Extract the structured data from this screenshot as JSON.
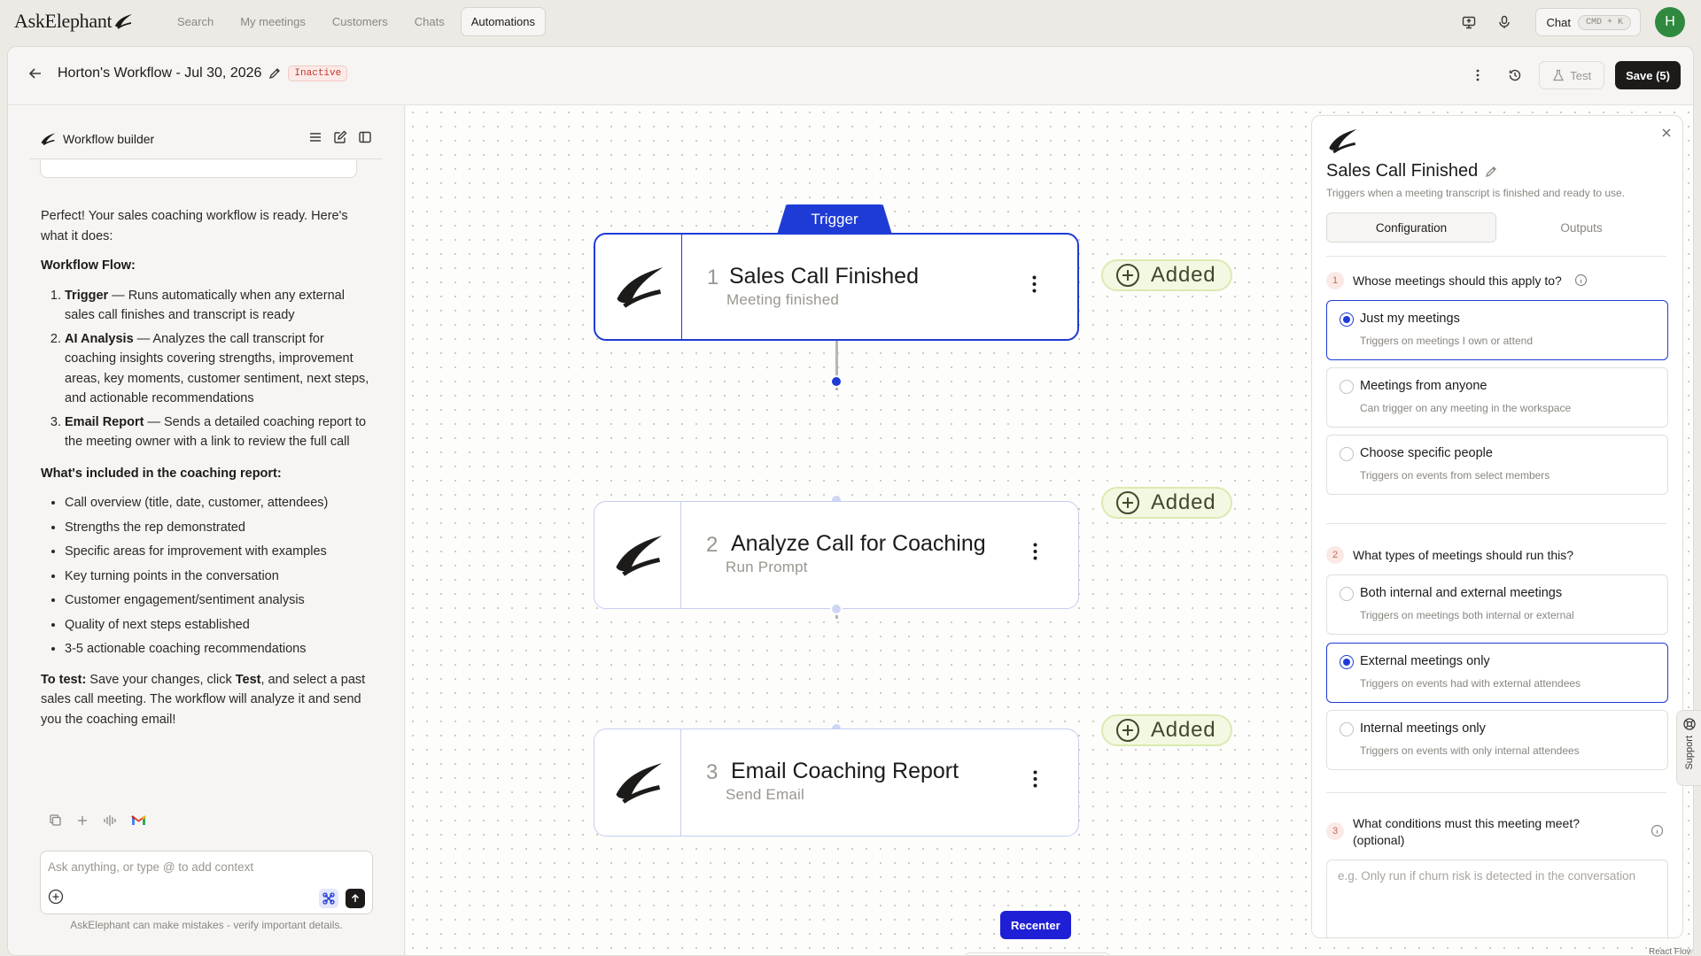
{
  "app": {
    "logo_text": "AskElephant",
    "nav": [
      "Search",
      "My meetings",
      "Customers",
      "Chats",
      "Automations"
    ],
    "active_nav": "Automations",
    "chat_label": "Chat",
    "chat_shortcut": "CMD + K",
    "avatar_initial": "H"
  },
  "workflow": {
    "title": "Horton's Workflow - Jul 30, 2026",
    "status": "Inactive",
    "test_label": "Test",
    "save_label": "Save (5)"
  },
  "builder": {
    "title": "Workflow builder",
    "intro": "Perfect! Your sales coaching workflow is ready. Here's what it does:",
    "flow_heading": "Workflow Flow:",
    "flow_steps": [
      {
        "name": "Trigger",
        "desc": " — Runs automatically when any external sales call finishes and transcript is ready"
      },
      {
        "name": "AI Analysis",
        "desc": " — Analyzes the call transcript for coaching insights covering strengths, improvement areas, key moments, customer sentiment, next steps, and actionable recommendations"
      },
      {
        "name": "Email Report",
        "desc": " — Sends a detailed coaching report to the meeting owner with a link to review the full call"
      }
    ],
    "included_heading": "What's included in the coaching report:",
    "included_items": [
      "Call overview (title, date, customer, attendees)",
      "Strengths the rep demonstrated",
      "Specific areas for improvement with examples",
      "Key turning points in the conversation",
      "Customer engagement/sentiment analysis",
      "Quality of next steps established",
      "3-5 actionable coaching recommendations"
    ],
    "test_lead": "To test:",
    "test_text_1": " Save your changes, click ",
    "test_bold": "Test",
    "test_text_2": ", and select a past sales call meeting. The workflow will analyze it and send you the coaching email!",
    "input_placeholder": "Ask anything, or type @ to add context",
    "disclaimer": "AskElephant can make mistakes - verify important details."
  },
  "canvas": {
    "trigger_label": "Trigger",
    "added_label": "Added",
    "recenter_label": "Recenter",
    "react_flow_label": "React Flow",
    "nodes": [
      {
        "num": "1",
        "title": "Sales Call Finished",
        "sub": "Meeting finished"
      },
      {
        "num": "2",
        "title": "Analyze Call for Coaching",
        "sub": "Run Prompt"
      },
      {
        "num": "3",
        "title": "Email Coaching Report",
        "sub": "Send Email"
      }
    ]
  },
  "panel": {
    "title": "Sales Call Finished",
    "desc": "Triggers when a meeting transcript is finished and ready to use.",
    "tabs": [
      "Configuration",
      "Outputs"
    ],
    "q1": {
      "num": "1",
      "text": "Whose meetings should this apply to?"
    },
    "q1_options": [
      {
        "title": "Just my meetings",
        "sub": "Triggers on meetings I own or attend"
      },
      {
        "title": "Meetings from anyone",
        "sub": "Can trigger on any meeting in the workspace"
      },
      {
        "title": "Choose specific people",
        "sub": "Triggers on events from select members"
      }
    ],
    "q2": {
      "num": "2",
      "text": "What types of meetings should run this?"
    },
    "q2_options": [
      {
        "title": "Both internal and external meetings",
        "sub": "Triggers on meetings both internal or external"
      },
      {
        "title": "External meetings only",
        "sub": "Triggers on events had with external attendees"
      },
      {
        "title": "Internal meetings only",
        "sub": "Triggers on events with only internal attendees"
      }
    ],
    "q3": {
      "num": "3",
      "text": "What conditions must this meeting meet? (optional)"
    },
    "q3_placeholder": "e.g. Only run if churn risk is detected in the conversation",
    "support_label": "Support"
  },
  "colors": {
    "accent": "#1f3bd6",
    "added_bg": "#f3f8e3",
    "inactive": "#c0392b"
  }
}
